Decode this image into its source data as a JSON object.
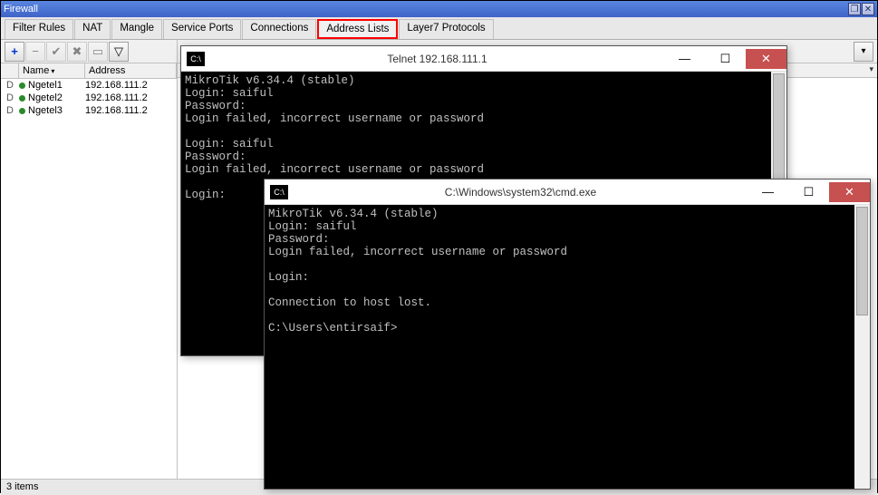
{
  "firewall": {
    "title": "Firewall",
    "tabs": [
      "Filter Rules",
      "NAT",
      "Mangle",
      "Service Ports",
      "Connections",
      "Address Lists",
      "Layer7 Protocols"
    ],
    "active_tab_index": 5,
    "toolbar_icons": [
      "plus",
      "minus",
      "check",
      "x",
      "note",
      "funnel"
    ],
    "columns": [
      "Name",
      "Address"
    ],
    "rows": [
      {
        "flag": "D",
        "name": "Ngetel1",
        "address": "192.168.111.2"
      },
      {
        "flag": "D",
        "name": "Ngetel2",
        "address": "192.168.111.2"
      },
      {
        "flag": "D",
        "name": "Ngetel3",
        "address": "192.168.111.2"
      }
    ],
    "status": "3 items"
  },
  "telnet_window": {
    "title": "Telnet 192.168.111.1",
    "lines": "MikroTik v6.34.4 (stable)\nLogin: saiful\nPassword:\nLogin failed, incorrect username or password\n\nLogin: saiful\nPassword:\nLogin failed, incorrect username or password\n\nLogin:"
  },
  "cmd_window": {
    "title": "C:\\Windows\\system32\\cmd.exe",
    "lines": "MikroTik v6.34.4 (stable)\nLogin: saiful\nPassword:\nLogin failed, incorrect username or password\n\nLogin:\n\nConnection to host lost.\n\nC:\\Users\\entirsaif>"
  }
}
